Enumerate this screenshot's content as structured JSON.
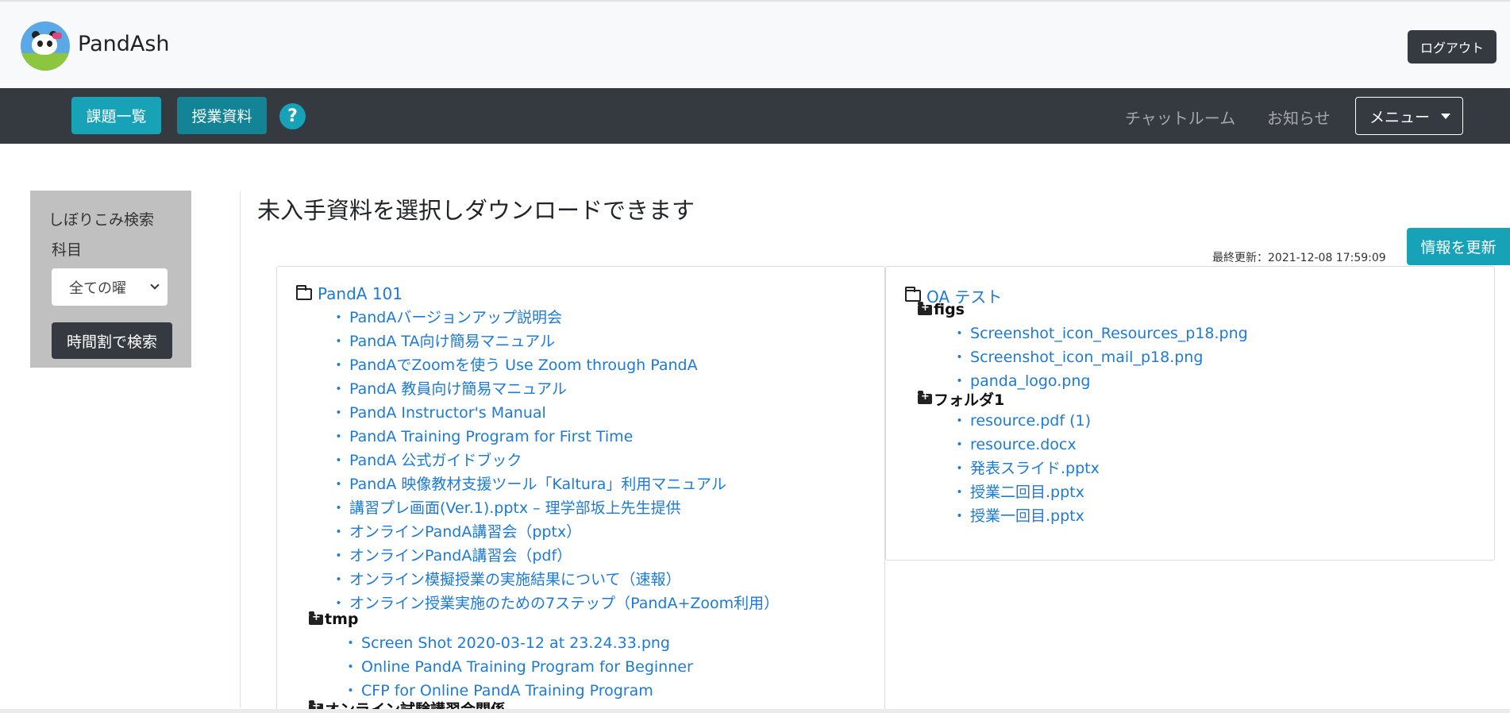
{
  "header": {
    "brand": "PandAsh",
    "logout_label": "ログアウト"
  },
  "nav": {
    "assignments_label": "課題一覧",
    "materials_label": "授業資料",
    "help_glyph": "?",
    "chat_label": "チャットルーム",
    "news_label": "お知らせ",
    "menu_label": "メニュー"
  },
  "sidebar": {
    "title": "しぼりこみ検索",
    "subject_label": "科目",
    "day_select_value": "全ての曜",
    "timetable_button": "時間割で検索"
  },
  "main": {
    "title": "未入手資料を選択しダウンロードできます",
    "last_updated": "最終更新：2021-12-08 17:59:09",
    "refresh_label": "情報を更新"
  },
  "left_course": {
    "name": "PandA 101",
    "files": [
      "PandAバージョンアップ説明会",
      "PandA TA向け簡易マニュアル",
      "PandAでZoomを使う Use Zoom through PandA",
      "PandA 教員向け簡易マニュアル",
      "PandA Instructor's Manual",
      "PandA Training Program for First Time",
      "PandA 公式ガイドブック",
      "PandA 映像教材支援ツール「Kaltura」利用マニュアル",
      "講習プレ画面(Ver.1).pptx – 理学部坂上先生提供",
      "オンラインPandA講習会（pptx）",
      "オンラインPandA講習会（pdf）",
      "オンライン模擬授業の実施結果について（速報）",
      "オンライン授業実施のための7ステップ（PandA+Zoom利用）"
    ],
    "subfolder_tmp": {
      "name": "tmp",
      "files": [
        "Screen Shot 2020-03-12 at 23.24.33.png",
        "Online PandA Training Program for Beginner",
        "CFP for Online PandA Training Program"
      ]
    },
    "subfolder_next": {
      "name": "オンライン試験講習会関係"
    }
  },
  "right_course": {
    "name": "OA テスト",
    "subfolder_figs": {
      "name": "figs",
      "files": [
        "Screenshot_icon_Resources_p18.png",
        "Screenshot_icon_mail_p18.png",
        "panda_logo.png"
      ]
    },
    "subfolder_1": {
      "name": "フォルダ1",
      "files": [
        "resource.pdf (1)",
        "resource.docx",
        "発表スライド.pptx",
        "授業二回目.pptx",
        "授業一回目.pptx"
      ]
    }
  },
  "bullet": "・"
}
